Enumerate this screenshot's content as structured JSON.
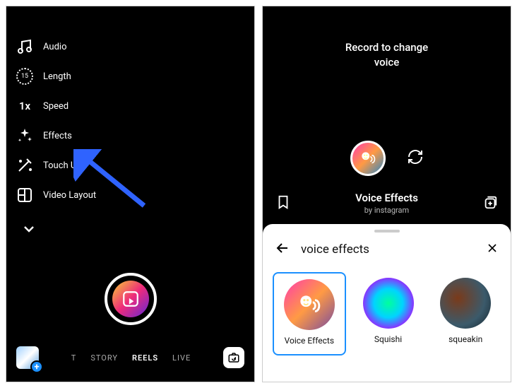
{
  "left": {
    "tools": {
      "audio": "Audio",
      "length": "Length",
      "length_value": "15",
      "speed": "Speed",
      "speed_value": "1x",
      "effects": "Effects",
      "touch_up": "Touch Up",
      "video_layout": "Video Layout"
    },
    "modes": {
      "cut": "T",
      "story": "STORY",
      "reels": "REELS",
      "live": "LIVE"
    }
  },
  "right": {
    "prompt_line1": "Record to change",
    "prompt_line2": "voice",
    "effect_title": "Voice Effects",
    "effect_by": "by instagram",
    "search_query": "voice effects",
    "effects": [
      {
        "label": "Voice Effects"
      },
      {
        "label": "Squishi"
      },
      {
        "label": "squeakin"
      }
    ]
  }
}
